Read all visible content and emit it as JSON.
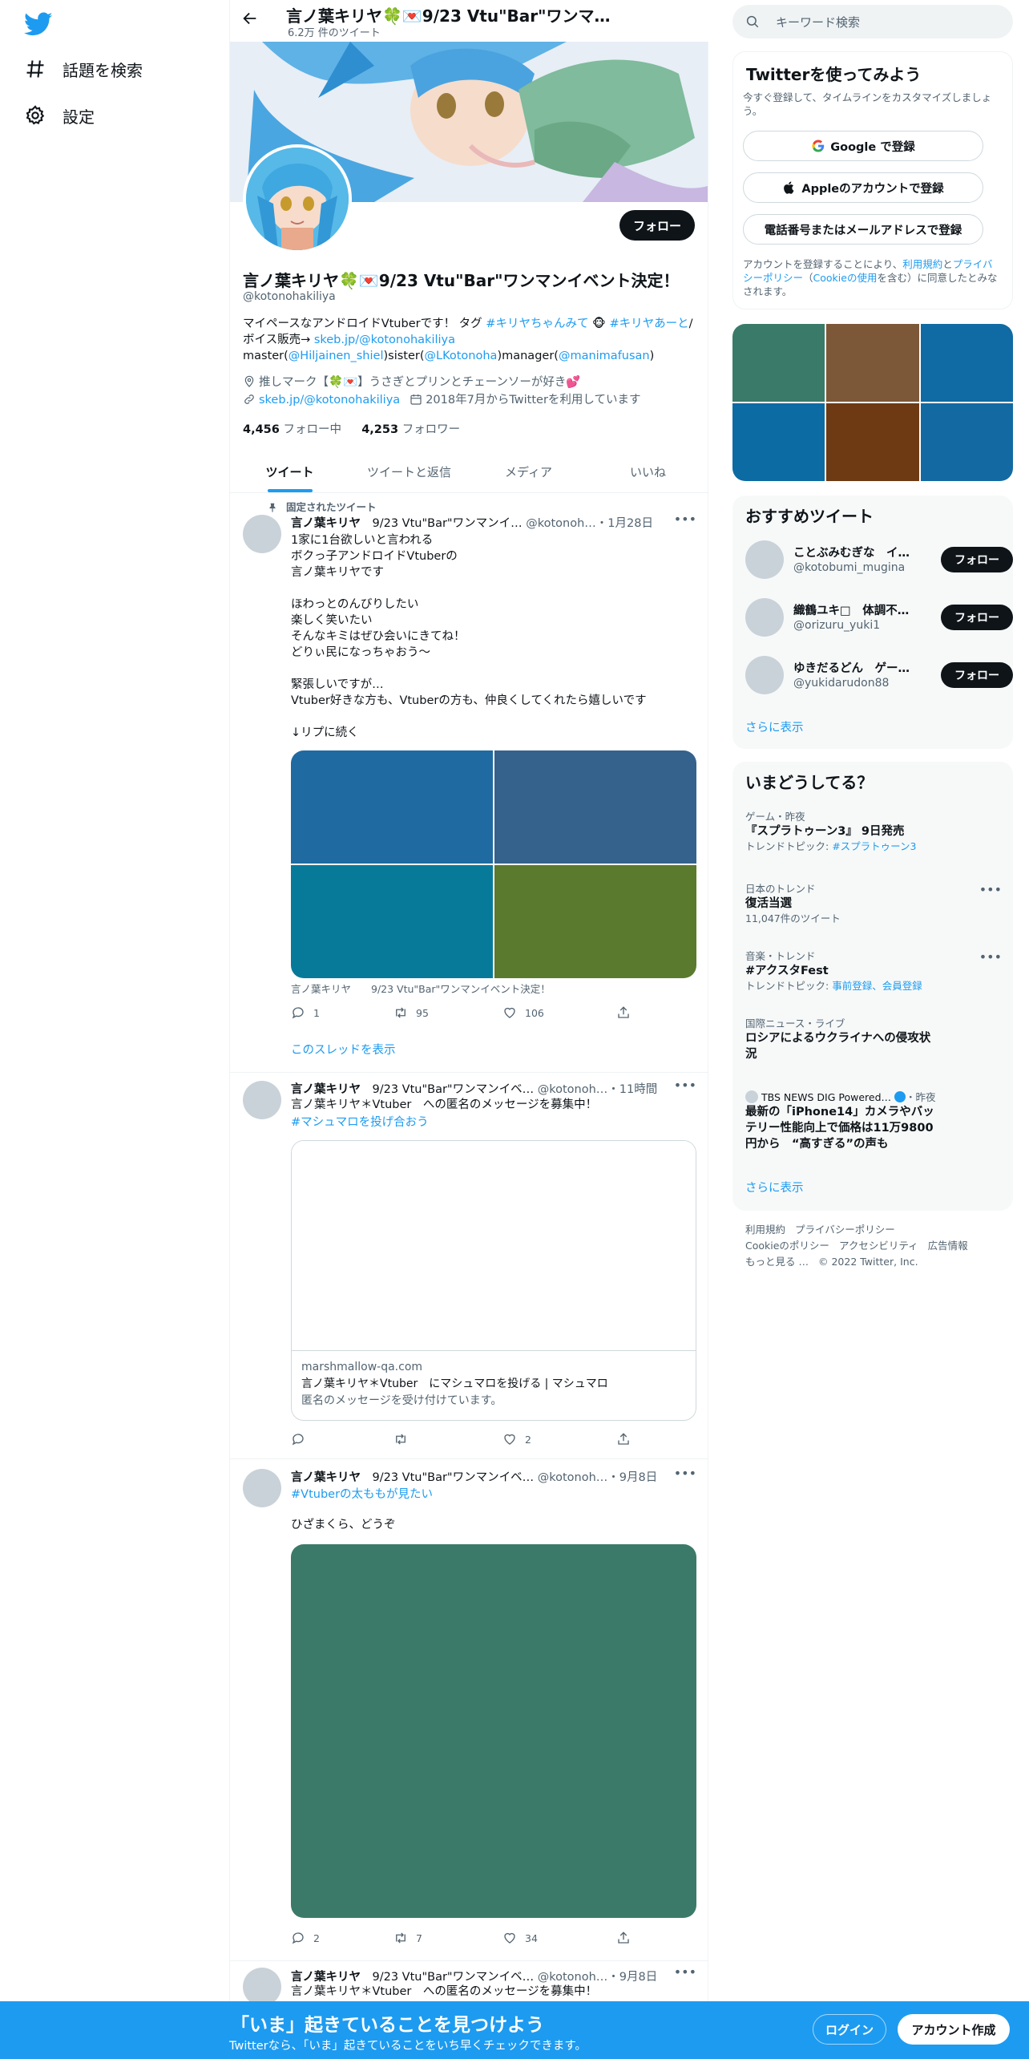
{
  "nav": {
    "explore_label": "話題を検索",
    "settings_label": "設定"
  },
  "header": {
    "title": "言ノ葉キリヤ🍀💌9/23 Vtu\"Bar\"ワンマンイ…",
    "tweet_count": "6.2万 件のツイート"
  },
  "profile": {
    "follow_label": "フォロー",
    "name": "言ノ葉キリヤ🍀💌9/23 Vtu\"Bar\"ワンマンイベント決定！",
    "handle": "@kotonohakiliya",
    "bio_1": "マイペースなアンドロイドVtuberです！ タグ ",
    "bio_tag1": "#キリヤちゃんみて",
    "bio_2": " 🐵 ",
    "bio_tag2": "#キリヤあーと",
    "bio_3": "/ボイス販売→ ",
    "bio_link": "skeb.jp/@kotonohakiliya",
    "bio_4": " master(",
    "bio_m1": "@Hiljainen_shiel",
    "bio_5": ")sister(",
    "bio_m2": "@LKotonoha",
    "bio_6": ")manager(",
    "bio_m3": "@manimafusan",
    "bio_7": ")",
    "location": "推しマーク【🍀💌】うさぎとプリンとチェーンソーが好き💕",
    "website": "skeb.jp/@kotonohakiliya",
    "joined": "2018年7月からTwitterを利用しています",
    "following_count": "4,456",
    "following_label": "フォロー中",
    "followers_count": "4,253",
    "followers_label": "フォロワー"
  },
  "tabs": [
    "ツイート",
    "ツイートと返信",
    "メディア",
    "いいね"
  ],
  "tweets": [
    {
      "pinned_label": "固定されたツイート",
      "name": "言ノ葉キリヤ",
      "name_suffix": "9/23 Vtu\"Bar\"ワンマンイ…",
      "handle": "@kotonoh…",
      "time": "・1月28日",
      "text": "1家に1台欲しいと言われる\nボクっ子アンドロイドVtuberの\n言ノ葉キリヤです\n\nほわっとのんびりしたい\n楽しく笑いたい\nそんなキミはぜひ会いにきてね！\nどりぃ民になっちゃおう～\n\n緊張しいですが…\nVtuber好きな方も、Vtuberの方も、仲良くしてくれたら嬉しいです\n\n↓リプに続く",
      "media_caption": "言ノ葉キリヤ　　9/23 Vtu\"Bar\"ワンマンイベント決定！",
      "media_colors": [
        "#1f6aa0",
        "#35628c",
        "#077a9a",
        "#5a7a2d"
      ],
      "reply_count": "1",
      "retweet_count": "95",
      "like_count": "106",
      "thread_link": "このスレッドを表示"
    },
    {
      "name": "言ノ葉キリヤ",
      "name_suffix": "9/23 Vtu\"Bar\"ワンマンイベ…",
      "handle": "@kotonoh…",
      "time": "・11時間",
      "text": "言ノ葉キリヤ＊Vtuber　への匿名のメッセージを募集中！",
      "hashtag": "#マシュマロを投げ合おう",
      "card_domain": "marshmallow-qa.com",
      "card_title": "言ノ葉キリヤ＊Vtuber　にマシュマロを投げる | マシュマロ",
      "card_desc": "匿名のメッセージを受け付けています。",
      "like_count": "2"
    },
    {
      "name": "言ノ葉キリヤ",
      "name_suffix": "9/23 Vtu\"Bar\"ワンマンイベ…",
      "handle": "@kotonoh…",
      "time": "・9月8日",
      "hashtag": "#Vtuberの太ももが見たい",
      "text": "ひざまくら、どうぞ",
      "media_color": "#3b7a68",
      "reply_count": "2",
      "retweet_count": "7",
      "like_count": "34"
    },
    {
      "name": "言ノ葉キリヤ",
      "name_suffix": "9/23 Vtu\"Bar\"ワンマンイベ…",
      "handle": "@kotonoh…",
      "time": "・9月8日",
      "text": "言ノ葉キリヤ＊Vtuber　への匿名のメッセージを募集中！"
    }
  ],
  "sidebar": {
    "search_placeholder": "キーワード検索",
    "signup": {
      "title": "Twitterを使ってみよう",
      "subtitle": "今すぐ登録して、タイムラインをカスタマイズしましょう。",
      "google_label": "Google で登録",
      "apple_label": "Appleのアカウントで登録",
      "phone_label": "電話番号またはメールアドレスで登録",
      "terms_1": "アカウントを登録することにより、",
      "terms_link1": "利用規約",
      "terms_2": "と",
      "terms_link2": "プライバシーポリシー",
      "terms_3": "（",
      "terms_link3": "Cookieの使用",
      "terms_4": "を含む）に同意したとみなされます。"
    },
    "media_colors": [
      "#3a7a68",
      "#7d5838",
      "#106aa3",
      "#0d6ba3",
      "#6e3a14",
      "#136aa3"
    ],
    "suggested": {
      "title": "おすすめツイート",
      "follow_label": "フォロー",
      "users": [
        {
          "name": "ことぶみむぎな　イ…",
          "handle": "@kotobumi_mugina"
        },
        {
          "name": "織鶴ユキ□　体調不…",
          "handle": "@orizuru_yuki1"
        },
        {
          "name": "ゆきだるどん　ゲー…",
          "handle": "@yukidarudon88"
        }
      ],
      "show_more": "さらに表示"
    },
    "trends": {
      "title": "いまどうしてる？",
      "items": [
        {
          "category": "ゲーム・昨夜",
          "title": "『スプラトゥーン3』 9日発売",
          "meta_1": "トレンドトピック: ",
          "meta_link": "#スプラトゥーン3"
        },
        {
          "category": "日本のトレンド",
          "title": "復活当選",
          "meta_1": "11,047件のツイート"
        },
        {
          "category": "音楽・トレンド",
          "title": "#アクスタFest",
          "meta_1": "トレンドトピック: ",
          "meta_link": "事前登録、会員登録"
        },
        {
          "category": "国際ニュース・ライブ",
          "title": "ロシアによるウクライナへの侵攻状況"
        },
        {
          "source": "TBS NEWS DIG Powered…",
          "time": "・昨夜",
          "title": "最新の「iPhone14」カメラやバッテリー性能向上で価格は11万9800円から　“高すぎる”の声も"
        }
      ],
      "show_more": "さらに表示"
    },
    "footer": {
      "links": [
        "利用規約",
        "プライバシーポリシー",
        "Cookieのポリシー",
        "アクセシビリティ",
        "広告情報",
        "もっと見る …"
      ],
      "copyright": "© 2022 Twitter, Inc."
    }
  },
  "bottom_bar": {
    "headline": "「いま」起きていることを見つけよう",
    "subtext": "Twitterなら、「いま」起きていることをいち早くチェックできます。",
    "login_label": "ログイン",
    "signup_label": "アカウント作成"
  },
  "colors": {
    "accent": "#1d9bf0",
    "bottom_bar": "#1d9bf0",
    "text": "#0f1419",
    "secondary": "#536471"
  }
}
